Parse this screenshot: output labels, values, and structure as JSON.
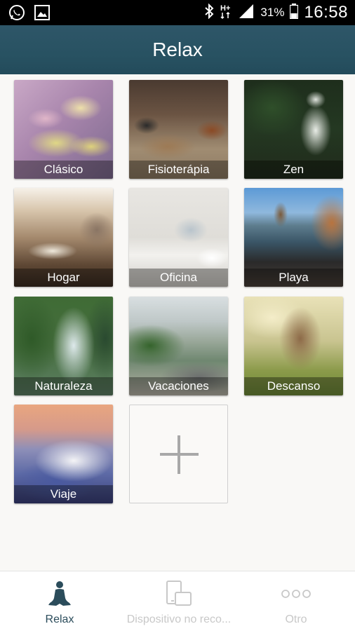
{
  "status_bar": {
    "battery": "31%",
    "time": "16:58",
    "icons": [
      "whatsapp-icon",
      "gallery-icon",
      "bluetooth-icon",
      "hplus-icon",
      "signal-icon",
      "battery-icon"
    ]
  },
  "app_bar": {
    "title": "Relax"
  },
  "tiles": [
    {
      "label": "Clásico"
    },
    {
      "label": "Fisioterápia"
    },
    {
      "label": "Zen"
    },
    {
      "label": "Hogar"
    },
    {
      "label": "Oficina"
    },
    {
      "label": "Playa"
    },
    {
      "label": "Naturaleza"
    },
    {
      "label": "Vacaciones"
    },
    {
      "label": "Descanso"
    },
    {
      "label": "Viaje"
    }
  ],
  "bottom_nav": {
    "items": [
      {
        "label": "Relax",
        "icon": "meditation-icon",
        "active": true
      },
      {
        "label": "Dispositivo no reco...",
        "icon": "devices-icon",
        "active": false
      },
      {
        "label": "Otro",
        "icon": "more-dots-icon",
        "active": false
      }
    ]
  }
}
